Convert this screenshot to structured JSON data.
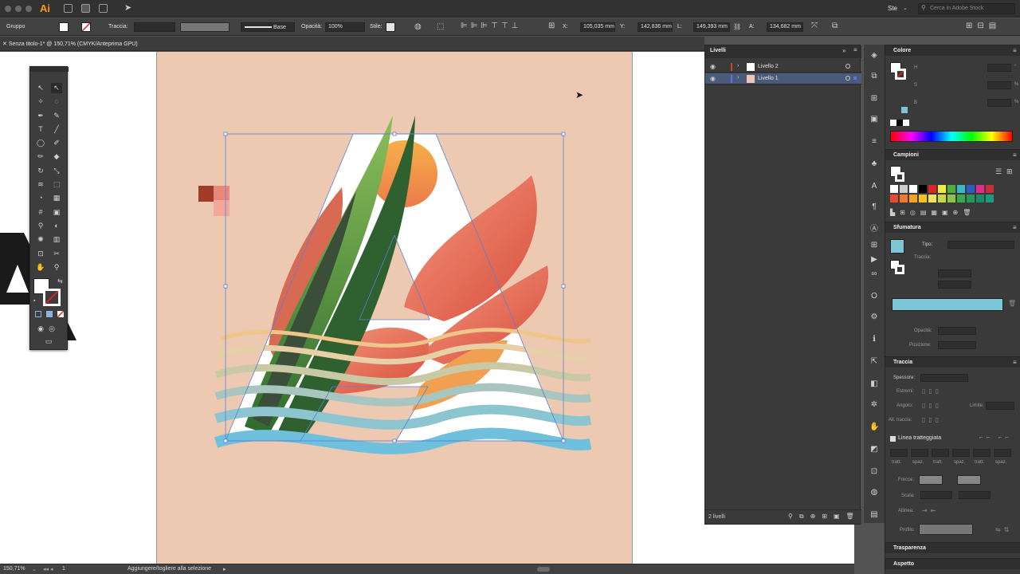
{
  "app": {
    "logo": "Ai",
    "workspace": "Ste",
    "stock_search_placeholder": "Cerca in Adobe Stock"
  },
  "control_bar": {
    "selection_type": "Gruppo",
    "stroke_label": "Traccia:",
    "stroke_profile": "Base",
    "opacity_label": "Opacità:",
    "opacity_value": "100%",
    "style_label": "Stile:",
    "x_label": "X:",
    "x_value": "105,035 mm",
    "y_label": "Y:",
    "y_value": "142,836 mm",
    "w_label": "L:",
    "w_value": "149,393 mm",
    "h_label": "A:",
    "h_value": "134,682 mm"
  },
  "document": {
    "tab_title": "Senza titolo-1* @ 150,71% (CMYK/Anteprima GPU)"
  },
  "status_bar": {
    "zoom": "150,71%",
    "artboard": "1",
    "hint": "Aggiungere/togliere alla selezione"
  },
  "layers": {
    "title": "Livelli",
    "items": [
      {
        "name": "Livello 2",
        "color": "#e03a3a"
      },
      {
        "name": "Livello 1",
        "color": "#4f7bd6"
      }
    ],
    "count": "2 livelli"
  },
  "colore": {
    "title": "Colore",
    "h": "H",
    "s": "S",
    "b": "B",
    "pct1": "%",
    "pct2": "%",
    "deg": "°"
  },
  "campioni": {
    "title": "Campioni"
  },
  "sfumatura": {
    "title": "Sfumatura",
    "tipo": "Tipo:",
    "traccia": "Traccia:",
    "opacita": "Opacità:",
    "posizione": "Posizione:",
    "gradient_color": "#7cc6d8"
  },
  "traccia": {
    "title": "Traccia",
    "spessore": "Spessore:",
    "estremi": "Estremi:",
    "angolo": "Angolo:",
    "limite": "Limite:",
    "all_traccia": "All. traccia:",
    "dashed": "Linea tratteggiata",
    "dash_labels": [
      "tratt.",
      "spaz.",
      "tratt.",
      "spaz.",
      "tratt.",
      "spaz."
    ],
    "frecce": "Frecce:",
    "scala": "Scala:",
    "allinea": "Allinea:",
    "profilo": "Profilo:"
  },
  "trasparenza": {
    "title": "Trasparenza"
  },
  "aspetto": {
    "title": "Aspetto"
  }
}
